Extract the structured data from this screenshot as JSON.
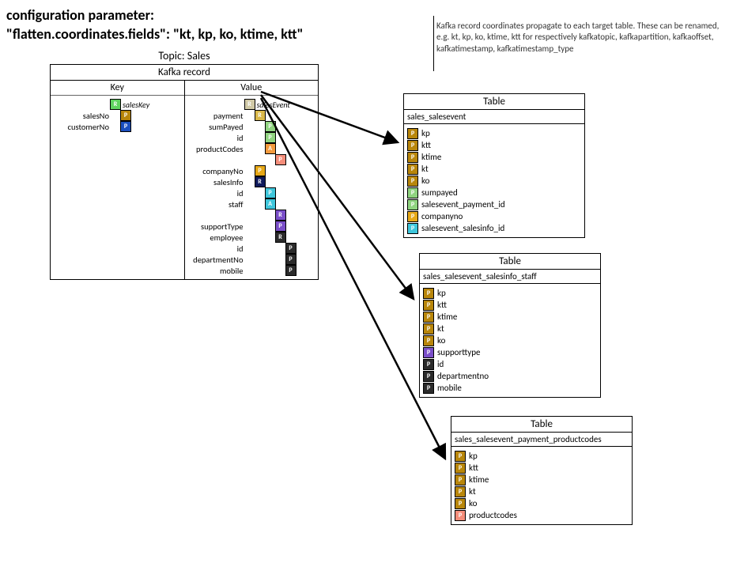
{
  "title_line1": "configuration parameter:",
  "title_line2": "\"flatten.coordinates.fields\": \"kt, kp, ko, ktime, ktt\"",
  "annotation": "Kafka record coordinates propagate to each target table. These can be renamed, e.g. kt, kp, ko, ktime, ktt for respectively kafkatopic, kafkapartition, kafkaoffset, kafkatimestamp, kafkatimestamp_type",
  "topic_label": "Topic: Sales",
  "kafka": {
    "header": "Kafka record",
    "key_head": "Key",
    "value_head": "Value",
    "key_rows": [
      {
        "label": "",
        "chips": [
          [
            "#5fd35f",
            "R"
          ]
        ],
        "note": "salesKey"
      },
      {
        "label": "salesNo",
        "chips": [
          [
            "#b8860b",
            "P"
          ]
        ]
      },
      {
        "label": "customerNo",
        "chips": [
          [
            "#1b4fbf",
            "P"
          ]
        ]
      }
    ],
    "value_rows": [
      {
        "label": "",
        "chips": [
          [
            "#d0c9a6",
            "R"
          ]
        ],
        "note": "salesEvent"
      },
      {
        "label": "payment",
        "chips": [
          [
            "#d9b84a",
            "R"
          ]
        ]
      },
      {
        "label": "sumPayed",
        "chips": [
          [
            "#8fd37f",
            "P"
          ]
        ]
      },
      {
        "label": "id",
        "chips": [
          [
            "#8fd37f",
            "P"
          ]
        ]
      },
      {
        "label": "productCodes",
        "chips": [
          [
            "#f39a3d",
            "A"
          ]
        ]
      },
      {
        "label": "",
        "chips": [
          [
            "#f58d7a",
            "P"
          ]
        ]
      },
      {
        "label": "companyNo",
        "chips": [
          [
            "#e6a817",
            "P"
          ]
        ]
      },
      {
        "label": "salesInfo",
        "chips": [
          [
            "#0f1a5c",
            "R"
          ]
        ]
      },
      {
        "label": "id",
        "chips": [
          [
            "#3ec6db",
            "P"
          ]
        ]
      },
      {
        "label": "staff",
        "chips": [
          [
            "#3ec6db",
            "A"
          ]
        ]
      },
      {
        "label": "",
        "chips": [
          [
            "#7a4ec9",
            "R"
          ]
        ]
      },
      {
        "label": "supportType",
        "chips": [
          [
            "#7a4ec9",
            "P"
          ]
        ]
      },
      {
        "label": "employee",
        "chips": [
          [
            "#2b2b2b",
            "R"
          ]
        ]
      },
      {
        "label": "id",
        "chips": [
          [
            "#2b2b2b",
            "P"
          ]
        ]
      },
      {
        "label": "departmentNo",
        "chips": [
          [
            "#2b2b2b",
            "P"
          ]
        ]
      },
      {
        "label": "mobile",
        "chips": [
          [
            "#2b2b2b",
            "P"
          ]
        ]
      }
    ]
  },
  "tables": [
    {
      "head": "Table",
      "name": "sales_salesevent",
      "rows": [
        {
          "c": [
            "#b8860b",
            "P"
          ],
          "t": "kp"
        },
        {
          "c": [
            "#b8860b",
            "P"
          ],
          "t": "ktt"
        },
        {
          "c": [
            "#b8860b",
            "P"
          ],
          "t": "ktime"
        },
        {
          "c": [
            "#b8860b",
            "P"
          ],
          "t": "kt"
        },
        {
          "c": [
            "#b8860b",
            "P"
          ],
          "t": "ko"
        },
        {
          "c": [
            "#8fd37f",
            "P"
          ],
          "t": "sumpayed"
        },
        {
          "c": [
            "#8fd37f",
            "P"
          ],
          "t": "salesevent_payment_id"
        },
        {
          "c": [
            "#e6a817",
            "P"
          ],
          "t": "companyno"
        },
        {
          "c": [
            "#3ec6db",
            "P"
          ],
          "t": "salesevent_salesinfo_id"
        }
      ]
    },
    {
      "head": "Table",
      "name": "sales_salesevent_salesinfo_staff",
      "rows": [
        {
          "c": [
            "#b8860b",
            "P"
          ],
          "t": "kp"
        },
        {
          "c": [
            "#b8860b",
            "P"
          ],
          "t": "ktt"
        },
        {
          "c": [
            "#b8860b",
            "P"
          ],
          "t": "ktime"
        },
        {
          "c": [
            "#b8860b",
            "P"
          ],
          "t": "kt"
        },
        {
          "c": [
            "#b8860b",
            "P"
          ],
          "t": "ko"
        },
        {
          "c": [
            "#7a4ec9",
            "P"
          ],
          "t": "supporttype"
        },
        {
          "c": [
            "#2b2b2b",
            "P"
          ],
          "t": "id"
        },
        {
          "c": [
            "#2b2b2b",
            "P"
          ],
          "t": "departmentno"
        },
        {
          "c": [
            "#2b2b2b",
            "P"
          ],
          "t": "mobile"
        }
      ]
    },
    {
      "head": "Table",
      "name": "sales_salesevent_payment_productcodes",
      "rows": [
        {
          "c": [
            "#b8860b",
            "P"
          ],
          "t": "kp"
        },
        {
          "c": [
            "#b8860b",
            "P"
          ],
          "t": "ktt"
        },
        {
          "c": [
            "#b8860b",
            "P"
          ],
          "t": "ktime"
        },
        {
          "c": [
            "#b8860b",
            "P"
          ],
          "t": "kt"
        },
        {
          "c": [
            "#b8860b",
            "P"
          ],
          "t": "ko"
        },
        {
          "c": [
            "#f58d7a",
            "P"
          ],
          "t": "productcodes"
        }
      ]
    }
  ]
}
